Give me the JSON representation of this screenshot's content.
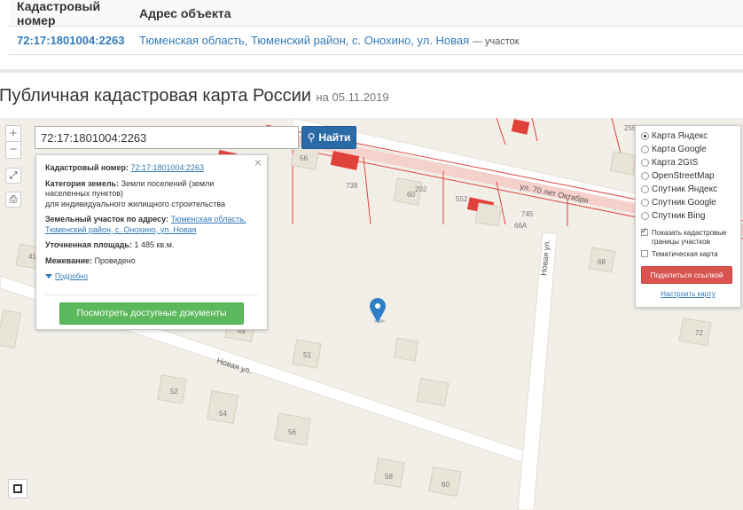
{
  "table": {
    "headers": [
      "Кадастровый номер",
      "Адрес объекта"
    ],
    "rows": [
      {
        "number": "72:17:1801004:2263",
        "address": "Тюменская область, Тюменский район, с. Онохино, ул. Новая",
        "suffix": "— участок"
      }
    ]
  },
  "title": {
    "main": "Публичная кадастровая карта России",
    "date": "на 05.11.2019"
  },
  "search": {
    "value": "72:17:1801004:2263",
    "button_label": "Найти"
  },
  "info": {
    "number_label": "Кадастровый номер:",
    "number_value": "72:17:1801004:2263",
    "category_label": "Категория земель:",
    "category_value": "Земли поселений (земли населенных пунктов)",
    "category_use": "для индивидуального жилищного строительства",
    "address_label": "Земельный участок по адресу:",
    "address_value": "Тюменская область, Тюменский район, с. Онохино, ул. Новая",
    "area_label": "Уточненная площадь:",
    "area_value": "1 485 кв.м.",
    "survey_label": "Межевание:",
    "survey_value": "Проведено",
    "more_link": "Подробно",
    "docs_button": "Посмотреть доступные документы"
  },
  "layers": {
    "options": [
      "Карта Яндекс",
      "Карта Google",
      "Карта 2GIS",
      "OpenStreetMap",
      "Спутник Яндекс",
      "Спутник Google",
      "Спутник Bing"
    ],
    "selected": "Карта Яндекс",
    "cadastral_borders": "Показать кадастровые границы участков",
    "thematic": "Тематическая карта",
    "share_button": "Поделиться ссылкой",
    "configure_link": "Настроить карту"
  },
  "map": {
    "street_labels": [
      "ул. 70 лет Октября",
      "Новая ул.",
      "Новая ул."
    ],
    "house_numbers": [
      "56",
      "738",
      "60",
      "202",
      "552",
      "745",
      "66А",
      "68",
      "41",
      "49",
      "51",
      "72",
      "52",
      "54",
      "56",
      "58",
      "60",
      "255"
    ],
    "colors": {
      "cadastral_line": "#e0423a",
      "building": "#e9e4d8",
      "road": "#ffffff",
      "pin": "#2f7fc8"
    }
  }
}
